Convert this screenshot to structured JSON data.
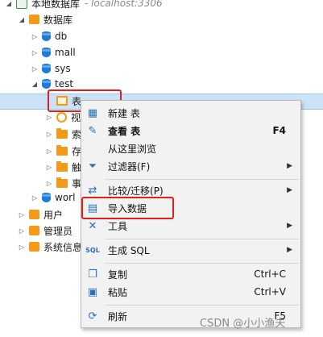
{
  "tree": {
    "connection": {
      "label": "本地数据库",
      "host": "- localhost:3306"
    },
    "databases_group": "数据库",
    "dbs": [
      "db",
      "mall",
      "sys",
      "test"
    ],
    "test_children": [
      "表",
      "视",
      "索",
      "存",
      "触",
      "事"
    ],
    "world": "worl",
    "users": "用户",
    "admin": "管理员",
    "sysinfo": "系统信息"
  },
  "menu": {
    "items": [
      {
        "label": "新建 表",
        "shortcut": "",
        "submenu": false,
        "icon": "new-table-icon"
      },
      {
        "label": "查看 表",
        "shortcut": "F4",
        "submenu": false,
        "icon": "edit-icon"
      },
      {
        "label": "从这里浏览",
        "shortcut": "",
        "submenu": false,
        "icon": ""
      },
      {
        "label": "过滤器(F)",
        "shortcut": "",
        "submenu": true,
        "icon": "filter-icon"
      },
      {
        "label": "比较/迁移(P)",
        "shortcut": "",
        "submenu": true,
        "icon": "compare-icon"
      },
      {
        "label": "导入数据",
        "shortcut": "",
        "submenu": false,
        "icon": "import-icon"
      },
      {
        "label": "工具",
        "shortcut": "",
        "submenu": true,
        "icon": "tools-icon"
      },
      {
        "label": "生成 SQL",
        "shortcut": "",
        "submenu": true,
        "icon": "sql-icon"
      },
      {
        "label": "复制",
        "shortcut": "Ctrl+C",
        "submenu": false,
        "icon": "copy-icon"
      },
      {
        "label": "粘贴",
        "shortcut": "Ctrl+V",
        "submenu": false,
        "icon": "paste-icon"
      },
      {
        "label": "刷新",
        "shortcut": "F5",
        "submenu": false,
        "icon": "refresh-icon"
      }
    ],
    "submenu_arrow": "▶"
  },
  "watermark": "CSDN @小小渔夫",
  "colors": {
    "highlight": "#cce3f7",
    "redbox": "#e02020",
    "folder": "#f29a19",
    "db": "#1c7cd6"
  }
}
